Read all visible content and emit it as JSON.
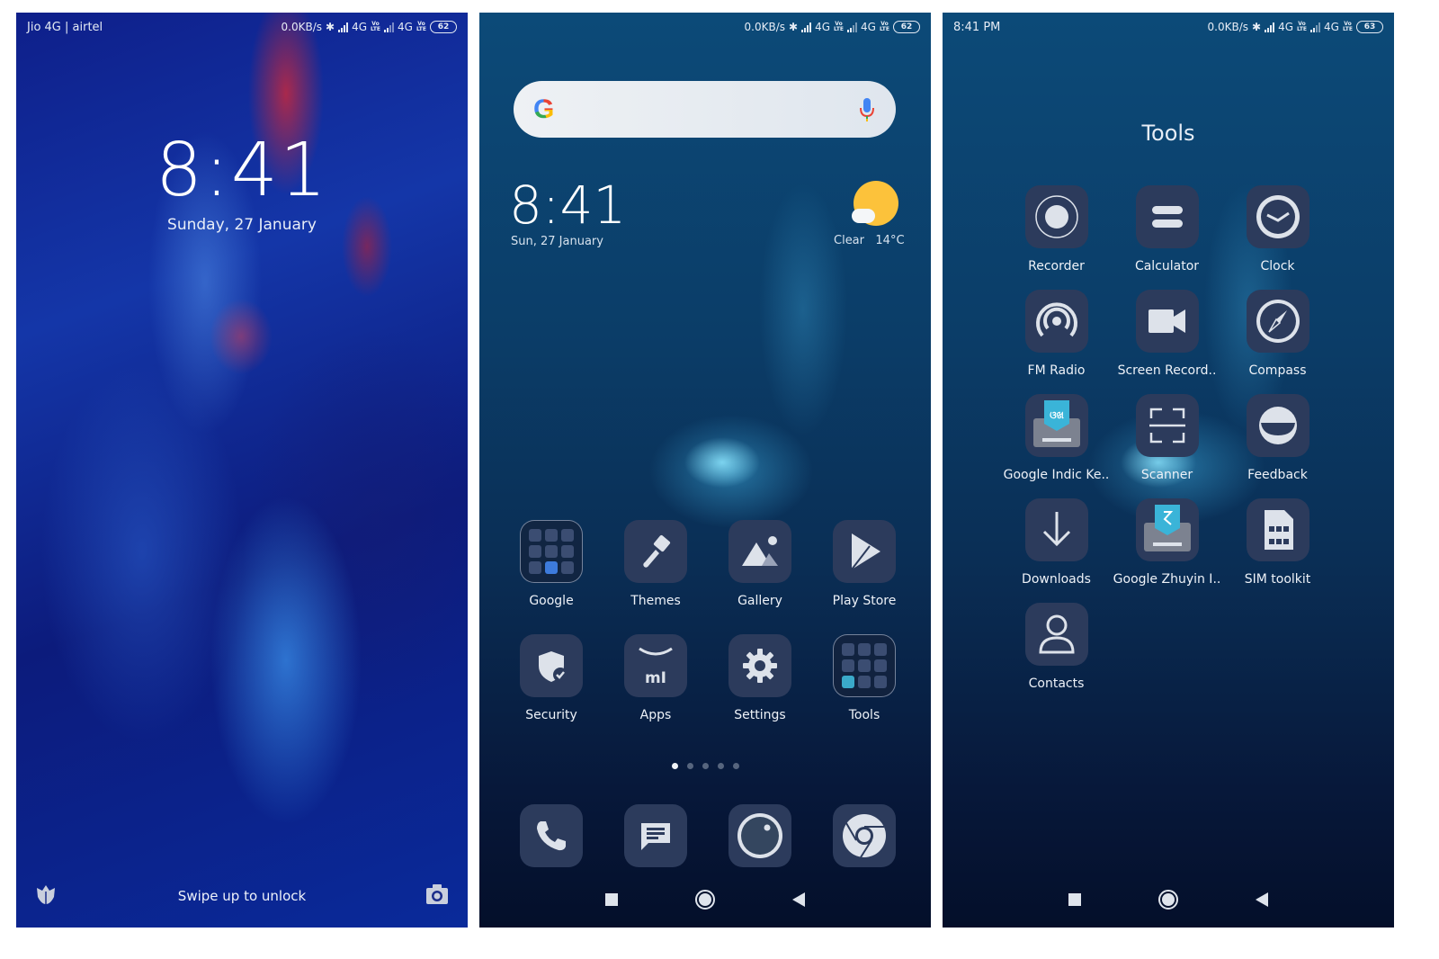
{
  "lock_screen": {
    "status": {
      "carrier": "Jio 4G | airtel",
      "net_speed": "0.0KB/s",
      "network1": "4G",
      "network2": "4G",
      "volte": "VoLTE",
      "battery": "62"
    },
    "time": "8:41",
    "date": "Sunday, 27 January",
    "swipe_hint": "Swipe up to unlock",
    "left_shortcut_icon": "flower-icon",
    "right_shortcut_icon": "camera-icon"
  },
  "home_screen": {
    "status": {
      "net_speed": "0.0KB/s",
      "network1": "4G",
      "network2": "4G",
      "volte": "VoLTE",
      "battery": "62"
    },
    "search": {
      "logo": "G",
      "mic_icon": "microphone-icon"
    },
    "clock": {
      "time": "8:41",
      "date": "Sun, 27 January"
    },
    "weather": {
      "condition": "Clear",
      "temperature": "14°C"
    },
    "apps": [
      {
        "label": "Google",
        "icon": "google-folder"
      },
      {
        "label": "Themes",
        "icon": "paintbrush-icon"
      },
      {
        "label": "Gallery",
        "icon": "gallery-icon"
      },
      {
        "label": "Play Store",
        "icon": "play-store-icon"
      },
      {
        "label": "Security",
        "icon": "shield-check-icon"
      },
      {
        "label": "Apps",
        "icon": "mi-store-icon"
      },
      {
        "label": "Settings",
        "icon": "gear-icon"
      },
      {
        "label": "Tools",
        "icon": "tools-folder"
      }
    ],
    "page_count": 5,
    "active_page": 1,
    "dock": [
      {
        "name": "phone",
        "icon": "phone-icon"
      },
      {
        "name": "messages",
        "icon": "message-icon"
      },
      {
        "name": "camera",
        "icon": "camera-lens-icon"
      },
      {
        "name": "chrome",
        "icon": "chrome-icon"
      }
    ]
  },
  "tools_folder": {
    "status": {
      "time": "8:41 PM",
      "net_speed": "0.0KB/s",
      "network1": "4G",
      "network2": "4G",
      "volte": "VoLTE",
      "battery": "63"
    },
    "title": "Tools",
    "apps": [
      {
        "label": "Recorder",
        "icon": "record-icon"
      },
      {
        "label": "Calculator",
        "icon": "equals-icon"
      },
      {
        "label": "Clock",
        "icon": "clock-icon"
      },
      {
        "label": "FM Radio",
        "icon": "radio-icon"
      },
      {
        "label": "Screen Record..",
        "icon": "video-camera-icon"
      },
      {
        "label": "Compass",
        "icon": "compass-icon"
      },
      {
        "label": "Google Indic Ke..",
        "icon": "indic-keyboard-icon"
      },
      {
        "label": "Scanner",
        "icon": "scan-icon"
      },
      {
        "label": "Feedback",
        "icon": "feedback-icon"
      },
      {
        "label": "Downloads",
        "icon": "download-arrow-icon"
      },
      {
        "label": "Google Zhuyin I..",
        "icon": "zhuyin-keyboard-icon"
      },
      {
        "label": "SIM toolkit",
        "icon": "sim-card-icon"
      },
      {
        "label": "Contacts",
        "icon": "person-icon"
      }
    ]
  }
}
